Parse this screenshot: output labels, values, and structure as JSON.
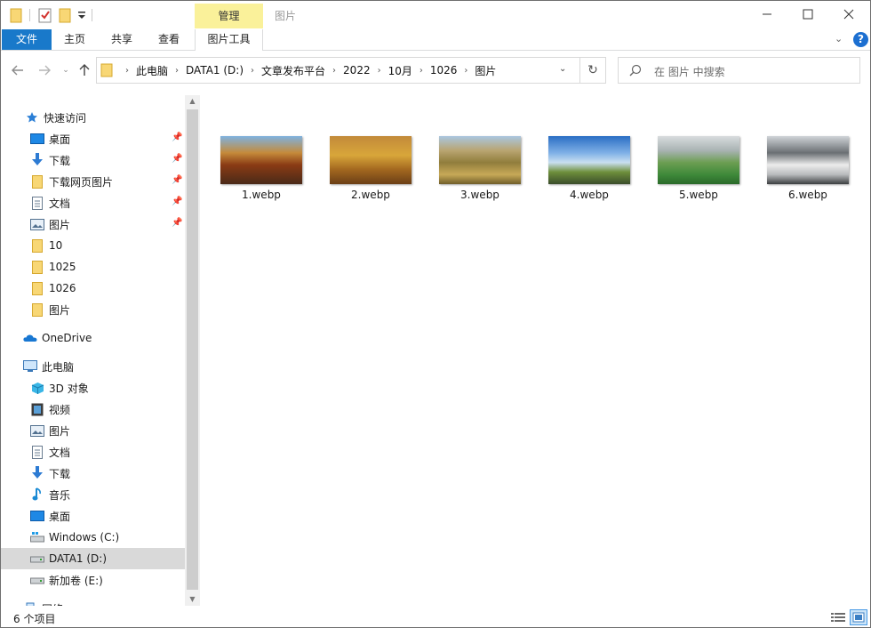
{
  "window": {
    "title": "图片",
    "contextual_tab_group": "管理"
  },
  "ribbon": {
    "tabs": [
      "文件",
      "主页",
      "共享",
      "查看",
      "图片工具"
    ]
  },
  "address": {
    "crumbs": [
      "此电脑",
      "DATA1 (D:)",
      "文章发布平台",
      "2022",
      "10月",
      "1026",
      "图片"
    ]
  },
  "search": {
    "placeholder": "在 图片 中搜索"
  },
  "nav": {
    "quick_access": "快速访问",
    "quick_items": [
      "桌面",
      "下载",
      "下载网页图片",
      "文档",
      "图片",
      "10",
      "1025",
      "1026",
      "图片"
    ],
    "onedrive": "OneDrive",
    "this_pc": "此电脑",
    "pc_items": [
      "3D 对象",
      "视频",
      "图片",
      "文档",
      "下载",
      "音乐",
      "桌面",
      "Windows (C:)",
      "DATA1 (D:)",
      "新加卷 (E:)"
    ],
    "network": "网络"
  },
  "files": [
    {
      "name": "1.webp"
    },
    {
      "name": "2.webp"
    },
    {
      "name": "3.webp"
    },
    {
      "name": "4.webp"
    },
    {
      "name": "5.webp"
    },
    {
      "name": "6.webp"
    }
  ],
  "status": {
    "count": "6 个项目"
  },
  "colors": {
    "accent": "#1979ca",
    "context_tab": "#faf19a",
    "selection": "#d9d9d9"
  }
}
